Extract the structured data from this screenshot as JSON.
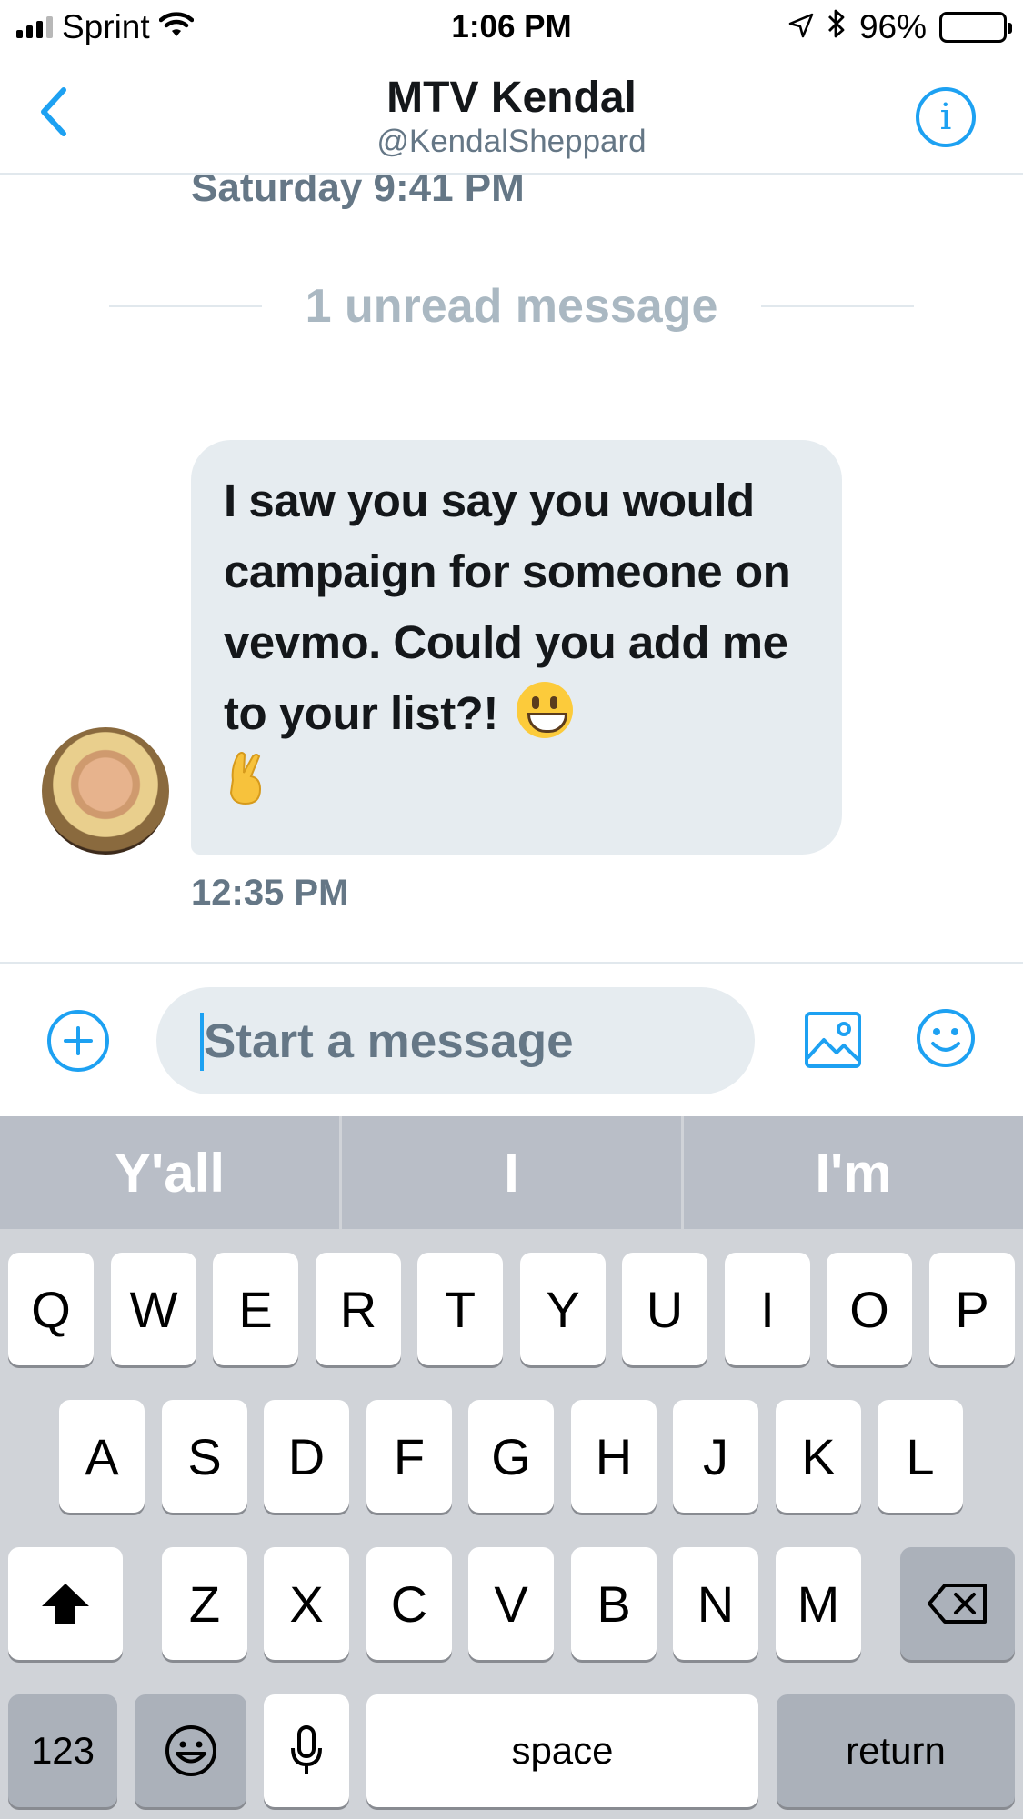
{
  "status_bar": {
    "carrier": "Sprint",
    "time": "1:06 PM",
    "battery": "96%",
    "icons": [
      "signal-icon",
      "wifi-icon",
      "location-icon",
      "bluetooth-icon",
      "battery-icon"
    ]
  },
  "header": {
    "title": "MTV Kendal",
    "handle": "@KendalSheppard",
    "accent_color": "#1da1f2"
  },
  "conversation": {
    "previous_timestamp": "Saturday 9:41 PM",
    "unread_divider": "1 unread message",
    "messages": [
      {
        "sender": "MTV Kendal",
        "text": "I saw you say you would campaign for someone on vevmo. Could you add me to your list?!",
        "emojis": [
          "grinning-face-emoji",
          "crossed-fingers-emoji"
        ],
        "time": "12:35 PM"
      }
    ]
  },
  "composer": {
    "placeholder": "Start a message"
  },
  "keyboard": {
    "predictions": [
      "Y'all",
      "I",
      "I'm"
    ],
    "row1": [
      "Q",
      "W",
      "E",
      "R",
      "T",
      "Y",
      "U",
      "I",
      "O",
      "P"
    ],
    "row2": [
      "A",
      "S",
      "D",
      "F",
      "G",
      "H",
      "J",
      "K",
      "L"
    ],
    "row3": [
      "Z",
      "X",
      "C",
      "V",
      "B",
      "N",
      "M"
    ],
    "numbers_key": "123",
    "space_key": "space",
    "return_key": "return"
  }
}
